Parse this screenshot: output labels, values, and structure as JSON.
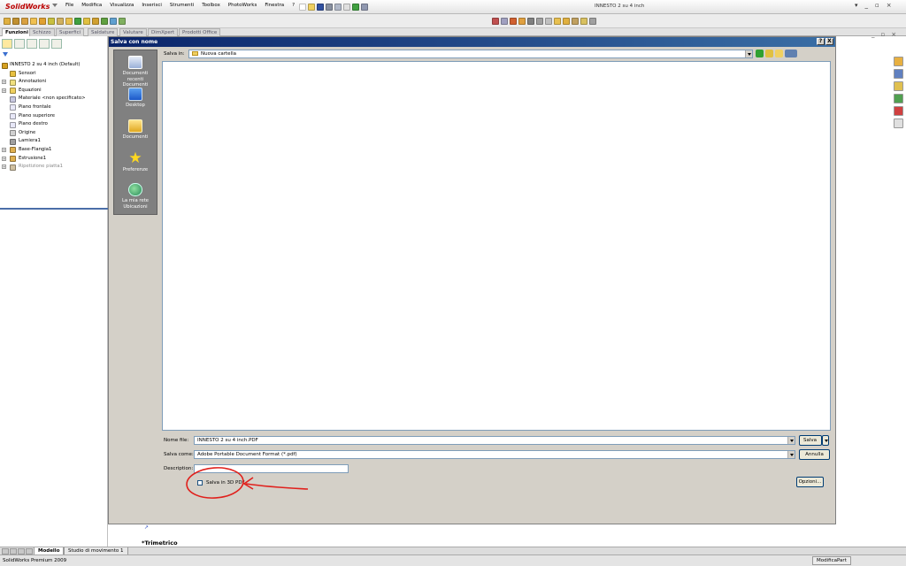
{
  "app": {
    "logo": "SolidWorks",
    "window_title": "INNESTO 2 su 4 inch",
    "menus": [
      "File",
      "Modifica",
      "Visualizza",
      "Inserisci",
      "Strumenti",
      "Toolbox",
      "PhotoWorks",
      "Finestra",
      "?"
    ]
  },
  "command_tabs": [
    "Funzioni",
    "Schizzo",
    "Superfici",
    "Saldature",
    "Valutare",
    "DimXpert",
    "Prodotti Office"
  ],
  "feature_tree": {
    "root": "INNESTO 2 su 4 inch  (Default)",
    "items": [
      {
        "label": "Sensori",
        "expandable": false,
        "color": "#e8c040"
      },
      {
        "label": "Annotazioni",
        "expandable": true,
        "color": "#f0e080"
      },
      {
        "label": "Equazioni",
        "expandable": true,
        "color": "#f0d060"
      },
      {
        "label": "Materiale <non specificato>",
        "expandable": false,
        "color": "#c8c8e0"
      },
      {
        "label": "Piano frontale",
        "expandable": false,
        "color": "#e8e8f8"
      },
      {
        "label": "Piano superiore",
        "expandable": false,
        "color": "#e8e8f8"
      },
      {
        "label": "Piano destro",
        "expandable": false,
        "color": "#e8e8f8"
      },
      {
        "label": "Origine",
        "expandable": false,
        "color": "#d0d0d0"
      },
      {
        "label": "Lamiera1",
        "expandable": false,
        "color": "#a0a0a0"
      },
      {
        "label": "Base-Flangia1",
        "expandable": true,
        "color": "#e0b050"
      },
      {
        "label": "Estrusione1",
        "expandable": true,
        "color": "#e0b050"
      },
      {
        "label": "Ripetizione piatta1",
        "expandable": true,
        "color": "#d0c0a0"
      }
    ]
  },
  "view": {
    "orientation_label": "*Trimetrico"
  },
  "model_tabs": [
    "Modello",
    "Studio di movimento 1"
  ],
  "status": {
    "left": "SolidWorks Premium 2009",
    "right": "ModificaPart"
  },
  "dialog": {
    "title": "Salva con nome",
    "title_buttons": [
      "?",
      "X"
    ],
    "save_in_label": "Salva in:",
    "save_in_value": "Nuova cartella",
    "places": [
      {
        "label": "Documenti recenti",
        "sub": "Documenti"
      },
      {
        "label": "Desktop",
        "sub": ""
      },
      {
        "label": "Documenti",
        "sub": ""
      },
      {
        "label": "Preferenze",
        "sub": ""
      },
      {
        "label": "La mia rete",
        "sub": "Ubicazioni"
      }
    ],
    "filename_label": "Nome file:",
    "filename_value": "INNESTO 2 su 4 inch.PDF",
    "save_as_label": "Salva come:",
    "save_as_value": "Adobe Portable Document Format (*.pdf)",
    "description_label": "Description:",
    "checkbox_label": "Salva in 3D PDF",
    "save_button": "Salva",
    "cancel_button": "Annulla",
    "options_button": "Opzioni..."
  },
  "annotation": {
    "color": "#e0201c"
  }
}
